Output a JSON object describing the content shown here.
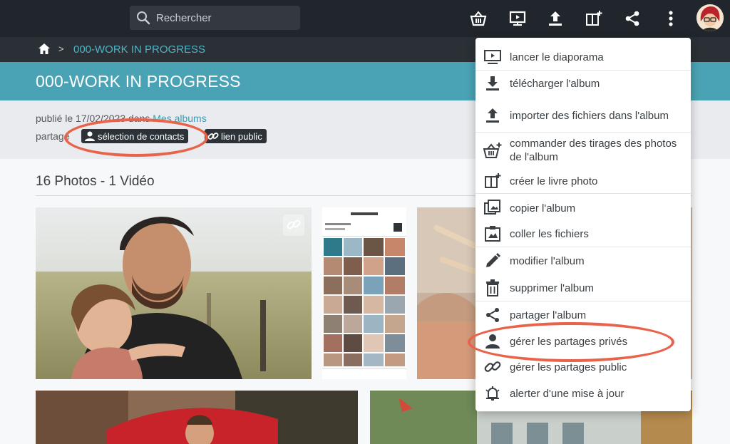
{
  "topbar": {
    "search_placeholder": "Rechercher",
    "icons": [
      "basket-icon",
      "slideshow-icon",
      "upload-icon",
      "photobook-add-icon",
      "share-icon",
      "more-vert-icon"
    ],
    "avatar": "user-avatar"
  },
  "breadcrumb": {
    "home_icon": "home-icon",
    "separator": ">",
    "current": "000-WORK IN PROGRESS"
  },
  "album": {
    "title": "000-WORK IN PROGRESS",
    "published_prefix": "publié le 17/02/2023 dans ",
    "published_link": "Mes albums",
    "shared_prefix": "partagé",
    "chips": {
      "contacts": "sélection de contacts",
      "public": "lien public"
    },
    "count": "16 Photos - 1 Vidéo"
  },
  "menu": {
    "items": [
      {
        "label": "lancer le diaporama",
        "icon": "slideshow-icon"
      },
      {
        "label": "télécharger l'album",
        "icon": "download-icon"
      },
      {
        "label": "importer des fichiers dans l'album",
        "icon": "upload-icon"
      },
      {
        "label": "commander des tirages des photos de l'album",
        "icon": "basket-add-icon"
      },
      {
        "label": "créer le livre photo",
        "icon": "photobook-add-icon"
      },
      {
        "label": "copier l'album",
        "icon": "copy-icon"
      },
      {
        "label": "coller les fichiers",
        "icon": "paste-icon"
      },
      {
        "label": "modifier l'album",
        "icon": "pencil-icon"
      },
      {
        "label": "supprimer l'album",
        "icon": "trash-icon"
      },
      {
        "label": "partager l'album",
        "icon": "share-icon"
      },
      {
        "label": "gérer les partages privés",
        "icon": "person-icon"
      },
      {
        "label": "gérer les partages public",
        "icon": "link-icon"
      },
      {
        "label": "alerter d'une mise à jour",
        "icon": "bell-alert-icon"
      }
    ]
  },
  "colors": {
    "topbar": "#20262b",
    "accent": "#4aa3b4",
    "link": "#4fb3c6",
    "annotation": "#e8634a"
  }
}
